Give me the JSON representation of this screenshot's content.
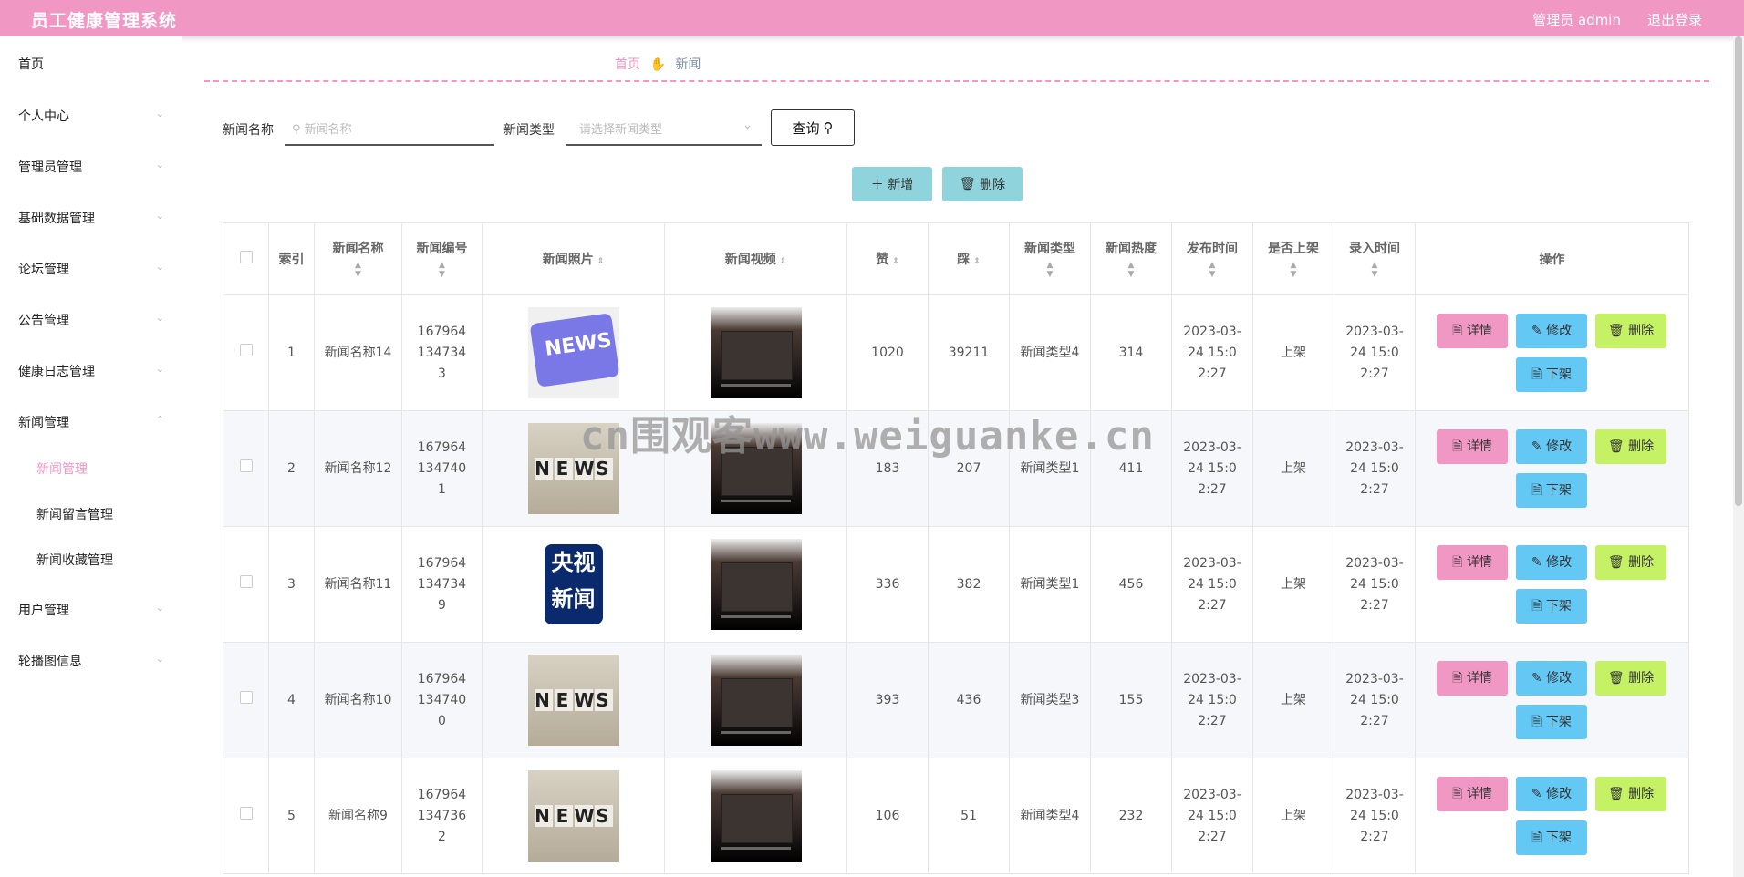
{
  "header": {
    "app_title": "员工健康管理系统",
    "admin_label": "管理员 admin",
    "logout": "退出登录"
  },
  "sidebar": {
    "items": [
      {
        "label": "首页",
        "has_chevron": false
      },
      {
        "label": "个人中心",
        "has_chevron": true
      },
      {
        "label": "管理员管理",
        "has_chevron": true
      },
      {
        "label": "基础数据管理",
        "has_chevron": true
      },
      {
        "label": "论坛管理",
        "has_chevron": true
      },
      {
        "label": "公告管理",
        "has_chevron": true
      },
      {
        "label": "健康日志管理",
        "has_chevron": true
      },
      {
        "label": "新闻管理",
        "has_chevron": true,
        "expanded": true
      },
      {
        "label": "用户管理",
        "has_chevron": true
      },
      {
        "label": "轮播图信息",
        "has_chevron": true
      }
    ],
    "subitems": [
      {
        "label": "新闻管理",
        "active": true
      },
      {
        "label": "新闻留言管理",
        "active": false
      },
      {
        "label": "新闻收藏管理",
        "active": false
      }
    ]
  },
  "breadcrumb": {
    "home": "首页",
    "current": "新闻",
    "separator_icon": "hand-icon"
  },
  "search": {
    "name_label": "新闻名称",
    "name_placeholder": "新闻名称",
    "type_label": "新闻类型",
    "type_placeholder": "请选择新闻类型",
    "query_button": "查询"
  },
  "actions": {
    "add": "新增",
    "delete": "删除"
  },
  "table": {
    "columns": [
      "索引",
      "新闻名称",
      "新闻编号",
      "新闻照片",
      "新闻视频",
      "赞",
      "踩",
      "新闻类型",
      "新闻热度",
      "发布时间",
      "是否上架",
      "录入时间",
      "操作"
    ],
    "rows": [
      {
        "index": "1",
        "name": "新闻名称14",
        "code": "1679641347343",
        "photo": "news-blue",
        "likes": "1020",
        "dislikes": "39211",
        "type": "新闻类型4",
        "heat": "314",
        "publish_time": "2023-03-24 15:02:27",
        "on_shelf": "上架",
        "entry_time": "2023-03-24 15:02:27"
      },
      {
        "index": "2",
        "name": "新闻名称12",
        "code": "1679641347401",
        "photo": "news-dice",
        "likes": "183",
        "dislikes": "207",
        "type": "新闻类型1",
        "heat": "411",
        "publish_time": "2023-03-24 15:02:27",
        "on_shelf": "上架",
        "entry_time": "2023-03-24 15:02:27"
      },
      {
        "index": "3",
        "name": "新闻名称11",
        "code": "1679641347349",
        "photo": "cctv",
        "likes": "336",
        "dislikes": "382",
        "type": "新闻类型1",
        "heat": "456",
        "publish_time": "2023-03-24 15:02:27",
        "on_shelf": "上架",
        "entry_time": "2023-03-24 15:02:27"
      },
      {
        "index": "4",
        "name": "新闻名称10",
        "code": "1679641347400",
        "photo": "news-dice",
        "likes": "393",
        "dislikes": "436",
        "type": "新闻类型3",
        "heat": "155",
        "publish_time": "2023-03-24 15:02:27",
        "on_shelf": "上架",
        "entry_time": "2023-03-24 15:02:27"
      },
      {
        "index": "5",
        "name": "新闻名称9",
        "code": "1679641347362",
        "photo": "news-dice",
        "likes": "106",
        "dislikes": "51",
        "type": "新闻类型4",
        "heat": "232",
        "publish_time": "2023-03-24 15:02:27",
        "on_shelf": "上架",
        "entry_time": "2023-03-24 15:02:27"
      }
    ],
    "ops": {
      "detail": "详情",
      "edit": "修改",
      "delete": "删除",
      "off_shelf": "下架"
    }
  },
  "photo_text": {
    "news_blue": "NEWS",
    "news_dice": "NEWS",
    "cctv_line1": "央视",
    "cctv_line2": "新闻"
  },
  "watermark": "cn围观客www.weiguanke.cn",
  "colors": {
    "accent": "#f197c4",
    "header_bg": "#f197c4",
    "detail_btn": "#f197c4",
    "edit_btn": "#64c8f5",
    "delete_btn": "#c5f165",
    "add_btn": "#8fd3dc"
  }
}
